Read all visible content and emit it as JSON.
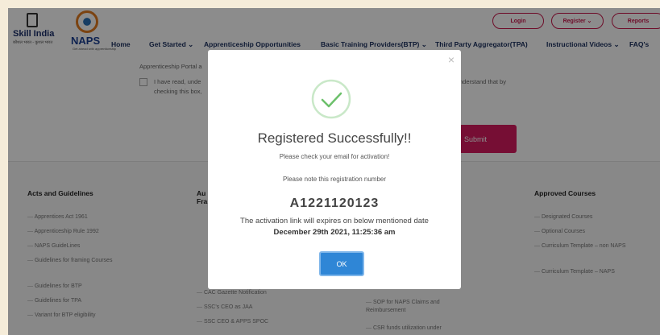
{
  "logos": {
    "skill_india": "Skill India",
    "skill_india_tagline": "कौशल भारत - कुशल भारत",
    "naps": "NAPS",
    "naps_tagline": "Get ahead with apprenticeship"
  },
  "nav": {
    "home": "Home",
    "get_started": "Get Started ⌄",
    "apprenticeship": "Apprenticeship Opportunities",
    "btp": "Basic Training Providers(BTP) ⌄",
    "tpa": "Third Party Aggregator(TPA)",
    "videos": "Instructional Videos ⌄",
    "faq": "FAQ's",
    "login": "Login",
    "register": "Register ⌄",
    "reports": "Reports"
  },
  "form": {
    "portal_text": "Apprenticeship Portal a",
    "checkbox_text_1": "I have read, unde",
    "checkbox_text_2": "checking this box,",
    "right_text": "nderstand that by",
    "submit_label": "Submit"
  },
  "footer": {
    "col1": {
      "title": "Acts and Guidelines",
      "links": [
        "Apprentices Act 1961",
        "Apprenticeship Rule 1992",
        "NAPS GuideLines",
        "Guidelines for framing Courses",
        "Guidelines for BTP",
        "Guidelines for TPA",
        "Variant for BTP eligibility"
      ]
    },
    "col2": {
      "title_1": "Au",
      "title_2": "Fra",
      "links": [
        "CAC Gazette Notification",
        "SSC's CEO as JAA",
        "SSC CEO & APPS SPOC"
      ]
    },
    "col3": {
      "links": [
        "SOP for NAPS Claims and Reimbursement",
        "CSR funds utilization under"
      ]
    },
    "col4": {
      "title": "Approved Courses",
      "links": [
        "Designated Courses",
        "Optional Courses",
        "Curriculum Template – non NAPS",
        "Curriculum Template – NAPS"
      ]
    }
  },
  "modal": {
    "title": "Registered Successfully!!",
    "check_email": "Please check your email for activation!",
    "note": "Please note this registration number",
    "reg_number": "A1221120123",
    "expiry_text": "The activation link will expires on below mentioned date",
    "expiry_date": "December 29th 2021, 11:25:36 am",
    "ok_label": "OK",
    "close_label": "×"
  },
  "colors": {
    "accent": "#d81b60",
    "ok_button": "#2f86d6",
    "success_green": "#6cc06b"
  }
}
